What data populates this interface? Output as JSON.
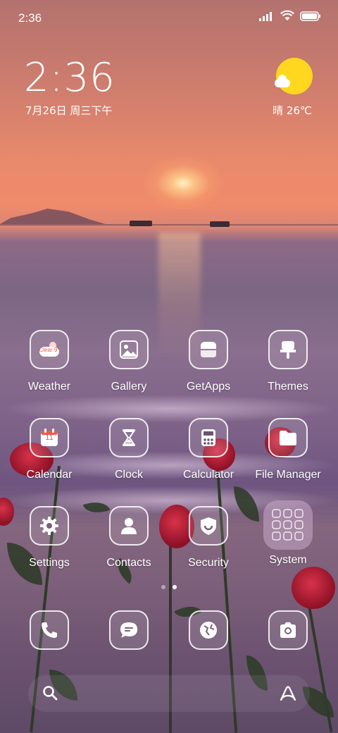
{
  "status_bar": {
    "time": "2:36",
    "icons": [
      "signal-icon",
      "wifi-icon",
      "battery-icon"
    ]
  },
  "clock_widget": {
    "time": "2:36",
    "date": "7月26日 周三下午"
  },
  "weather_widget": {
    "condition_temp": "晴 26℃",
    "icon": "sun-cloud-icon",
    "sun_color": "#ffd71e"
  },
  "apps": [
    {
      "name": "weather-app",
      "label": "Weather",
      "icon": "weather-icon"
    },
    {
      "name": "gallery-app",
      "label": "Gallery",
      "icon": "gallery-icon"
    },
    {
      "name": "getapps-app",
      "label": "GetApps",
      "icon": "getapps-icon"
    },
    {
      "name": "themes-app",
      "label": "Themes",
      "icon": "themes-icon"
    },
    {
      "name": "calendar-app",
      "label": "Calendar",
      "icon": "calendar-icon",
      "icon_text": "11"
    },
    {
      "name": "clock-app",
      "label": "Clock",
      "icon": "hourglass-icon"
    },
    {
      "name": "calculator-app",
      "label": "Calculator",
      "icon": "calculator-icon"
    },
    {
      "name": "file-manager-app",
      "label": "File Manager",
      "icon": "folder-icon"
    },
    {
      "name": "settings-app",
      "label": "Settings",
      "icon": "gear-icon"
    },
    {
      "name": "contacts-app",
      "label": "Contacts",
      "icon": "person-icon"
    },
    {
      "name": "security-app",
      "label": "Security",
      "icon": "shield-icon"
    },
    {
      "name": "system-folder",
      "label": "System",
      "icon": "folder-preview-icon"
    }
  ],
  "weather_icon_text": "Clear 9°",
  "page_indicator": {
    "pages": 2,
    "active": 2
  },
  "dock": [
    {
      "name": "phone-app",
      "icon": "phone-icon"
    },
    {
      "name": "messages-app",
      "icon": "message-icon"
    },
    {
      "name": "browser-app",
      "icon": "globe-icon"
    },
    {
      "name": "camera-app",
      "icon": "camera-icon"
    }
  ],
  "search_bar": {
    "left_icon": "search-icon",
    "right_icon": "assistant-icon"
  }
}
